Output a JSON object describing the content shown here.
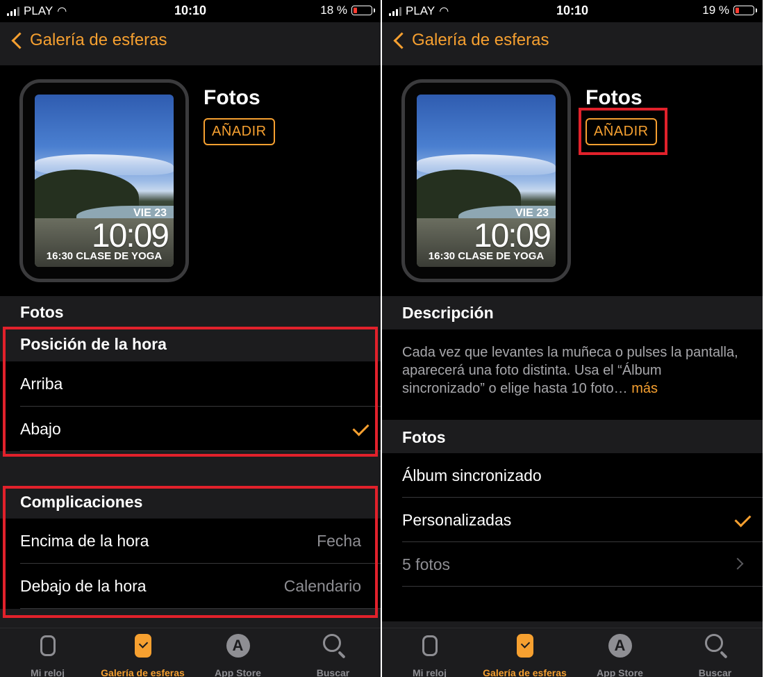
{
  "left": {
    "status": {
      "carrier": "PLAY",
      "time": "10:10",
      "battery_pct": "18 %"
    },
    "nav": {
      "back_label": "Galería de esferas"
    },
    "face": {
      "title": "Fotos",
      "add_label": "AÑADIR",
      "watch_date": "VIE 23",
      "watch_time": "10:09",
      "watch_complication": "16:30 CLASE DE YOGA"
    },
    "section_fotos": {
      "header": "Fotos"
    },
    "section_position": {
      "header": "Posición de la hora",
      "rows": [
        {
          "label": "Arriba",
          "checked": false
        },
        {
          "label": "Abajo",
          "checked": true
        }
      ]
    },
    "section_complications": {
      "header": "Complicaciones",
      "rows": [
        {
          "label": "Encima de la hora",
          "value": "Fecha"
        },
        {
          "label": "Debajo de la hora",
          "value": "Calendario"
        }
      ]
    }
  },
  "right": {
    "status": {
      "carrier": "PLAY",
      "time": "10:10",
      "battery_pct": "19 %"
    },
    "nav": {
      "back_label": "Galería de esferas"
    },
    "face": {
      "title": "Fotos",
      "add_label": "AÑADIR",
      "watch_date": "VIE 23",
      "watch_time": "10:09",
      "watch_complication": "16:30 CLASE DE YOGA"
    },
    "description": {
      "header": "Descripción",
      "text": "Cada vez que levantes la muñeca o pulses la pantalla, aparecerá una foto distinta. Usa el “Álbum sincronizado” o elige hasta 10 foto…",
      "more_label": "más"
    },
    "section_fotos": {
      "header": "Fotos",
      "rows": [
        {
          "label": "Álbum sincronizado"
        },
        {
          "label": "Personalizadas",
          "checked": true
        },
        {
          "label": "5 fotos"
        }
      ]
    }
  },
  "tabbar": {
    "tabs": [
      {
        "label": "Mi reloj",
        "icon": "watch-icon"
      },
      {
        "label": "Galería de esferas",
        "icon": "watch-face-gallery-icon",
        "active": true
      },
      {
        "label": "App Store",
        "icon": "app-store-icon"
      },
      {
        "label": "Buscar",
        "icon": "search-icon"
      }
    ]
  },
  "colors": {
    "accent": "#f6a030",
    "highlight": "#e1212b",
    "background": "#000000",
    "section": "#1c1c1e"
  }
}
